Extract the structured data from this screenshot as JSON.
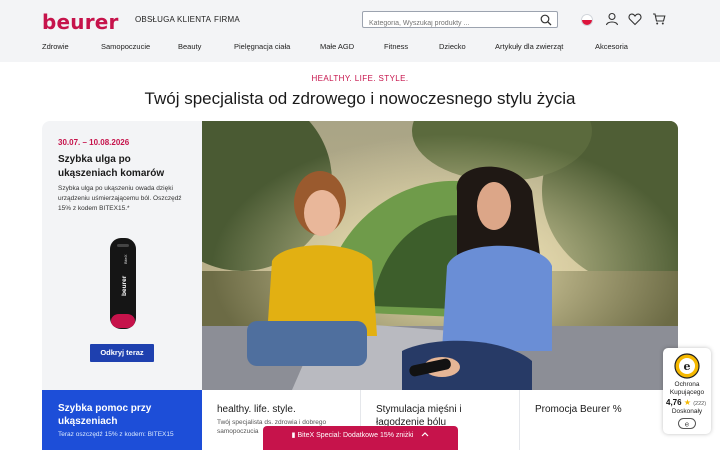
{
  "header": {
    "logo": "beurer",
    "links": [
      "OBSŁUGA KLIENTA",
      "FIRMA"
    ],
    "search_placeholder": "Kategoria, Wyszukaj produkty ...",
    "nav": [
      "Zdrowie",
      "Samopoczucie",
      "Beauty",
      "Pielęgnacja ciała",
      "Małe AGD",
      "Fitness",
      "Dziecko",
      "Artykuły dla zwierząt",
      "Akcesoria"
    ]
  },
  "hero": {
    "tagline": "HEALTHY. LIFE. STYLE.",
    "title": "Twój specjalista od zdrowego i nowoczesnego stylu życia"
  },
  "promo": {
    "date": "30.07. – 10.08.2026",
    "heading": "Szybka ulga po ukąszeniach komarów",
    "text": "Szybka ulga po ukąszeniu owada dzięki urządzeniu uśmierzającemu ból. Oszczędź 15% z kodem BITEX15.*",
    "device_brand": "beurer",
    "device_model": "BiteX",
    "button": "Odkryj teraz"
  },
  "cards": [
    {
      "heading": "Szybka pomoc przy ukąszeniach",
      "text": "Teraz oszczędź 15% z kodem: BITEX15"
    },
    {
      "heading": "healthy. life. style.",
      "text": "Twój specjalista ds. zdrowia i dobrego samopoczucia"
    },
    {
      "heading": "Stymulacja mięśni i łagodzenie bólu",
      "text": ""
    },
    {
      "heading": "Promocja Beurer %",
      "text": ""
    }
  ],
  "sticky_bar": {
    "label": "BiteX Special: Dodatkowe 15% zniżki"
  },
  "badge": {
    "seal_letter": "e",
    "label": "Ochrona Kupującego",
    "rating": "4,76",
    "count": "(222)",
    "verdict": "Doskonały"
  },
  "colors": {
    "brand": "#c6134b",
    "blue": "#1d4ed8"
  }
}
